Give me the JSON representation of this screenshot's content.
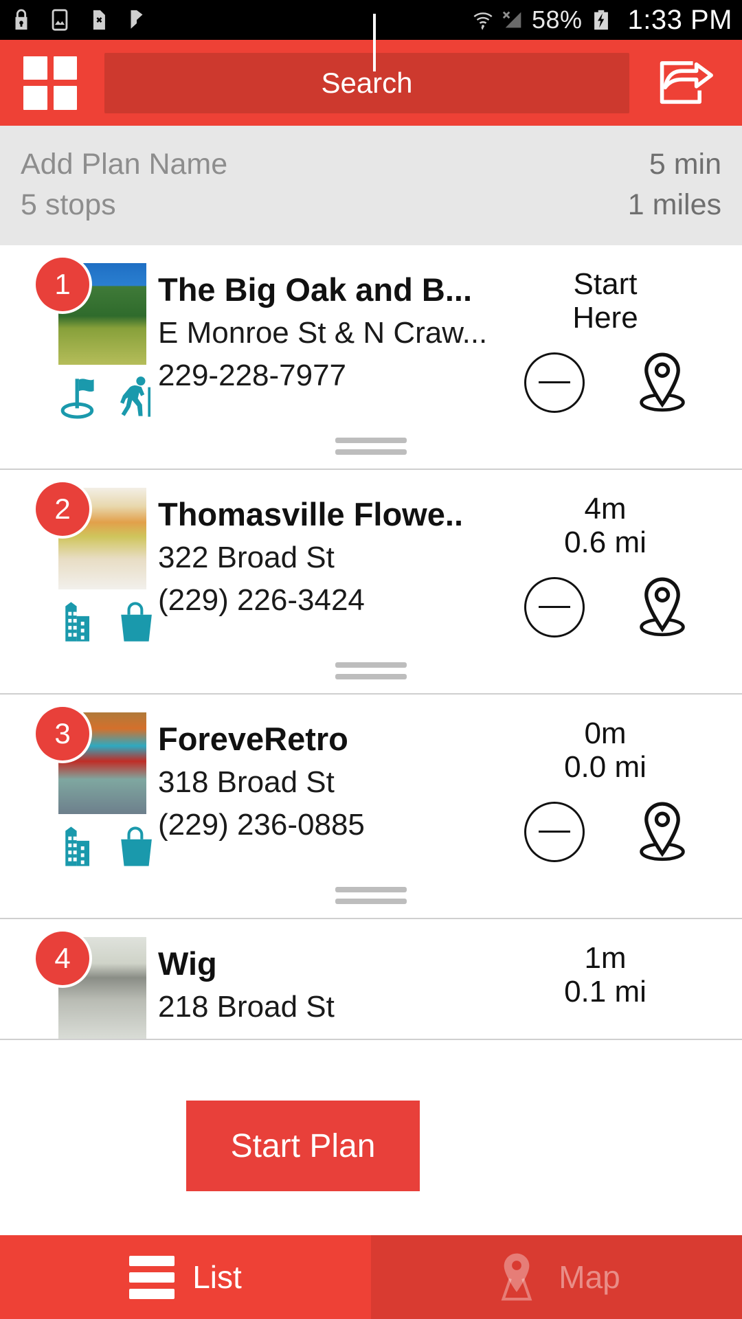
{
  "statusbar": {
    "icons": [
      "lock-icon",
      "image-icon",
      "sim-card-x-icon",
      "checkmark-flag-icon",
      "wifi-icon",
      "no-signal-icon"
    ],
    "battery_percent": "58%",
    "time": "1:33 PM"
  },
  "header": {
    "menu_icon": "grid-menu-icon",
    "search_label": "Search",
    "share_icon": "share-icon"
  },
  "plan": {
    "name_placeholder": "Add Plan Name",
    "stops_label": "5 stops",
    "duration": "5 min",
    "distance": "1 miles"
  },
  "stops": [
    {
      "number": "1",
      "title": "The Big Oak and B...",
      "address": "E Monroe St & N Craw...",
      "phone": "229-228-7977",
      "meta_line1": "Start",
      "meta_line2": "Here",
      "categories": [
        "golf-flag-icon",
        "hiking-icon"
      ],
      "thumb_class": "th-oak",
      "remove_icon": "minus-circle-icon",
      "pin_icon": "map-pin-icon"
    },
    {
      "number": "2",
      "title": "Thomasville Flowe..",
      "address": "322 Broad St",
      "phone": "(229) 226-3424",
      "meta_line1": "4m",
      "meta_line2": "0.6 mi",
      "categories": [
        "building-icon",
        "shopping-bag-icon"
      ],
      "thumb_class": "th-flowers",
      "remove_icon": "minus-circle-icon",
      "pin_icon": "map-pin-icon"
    },
    {
      "number": "3",
      "title": "ForeveRetro",
      "address": "318 Broad St",
      "phone": "(229) 236-0885",
      "meta_line1": "0m",
      "meta_line2": "0.0 mi",
      "categories": [
        "building-icon",
        "shopping-bag-icon"
      ],
      "thumb_class": "th-retro",
      "remove_icon": "minus-circle-icon",
      "pin_icon": "map-pin-icon"
    },
    {
      "number": "4",
      "title": "Wig",
      "address": "218 Broad St",
      "phone": "",
      "meta_line1": "1m",
      "meta_line2": "0.1 mi",
      "categories": [],
      "thumb_class": "th-store",
      "remove_icon": "minus-circle-icon",
      "pin_icon": "map-pin-icon"
    }
  ],
  "start_plan_label": "Start Plan",
  "bottomnav": {
    "list_label": "List",
    "map_label": "Map",
    "list_icon": "list-icon",
    "map_icon": "map-pin-icon"
  },
  "colors": {
    "brand_red": "#ee4136",
    "badge_red": "#e8403a",
    "search_red": "#cd392e",
    "teal": "#1a99ac",
    "plan_bg": "#e7e7e7"
  }
}
